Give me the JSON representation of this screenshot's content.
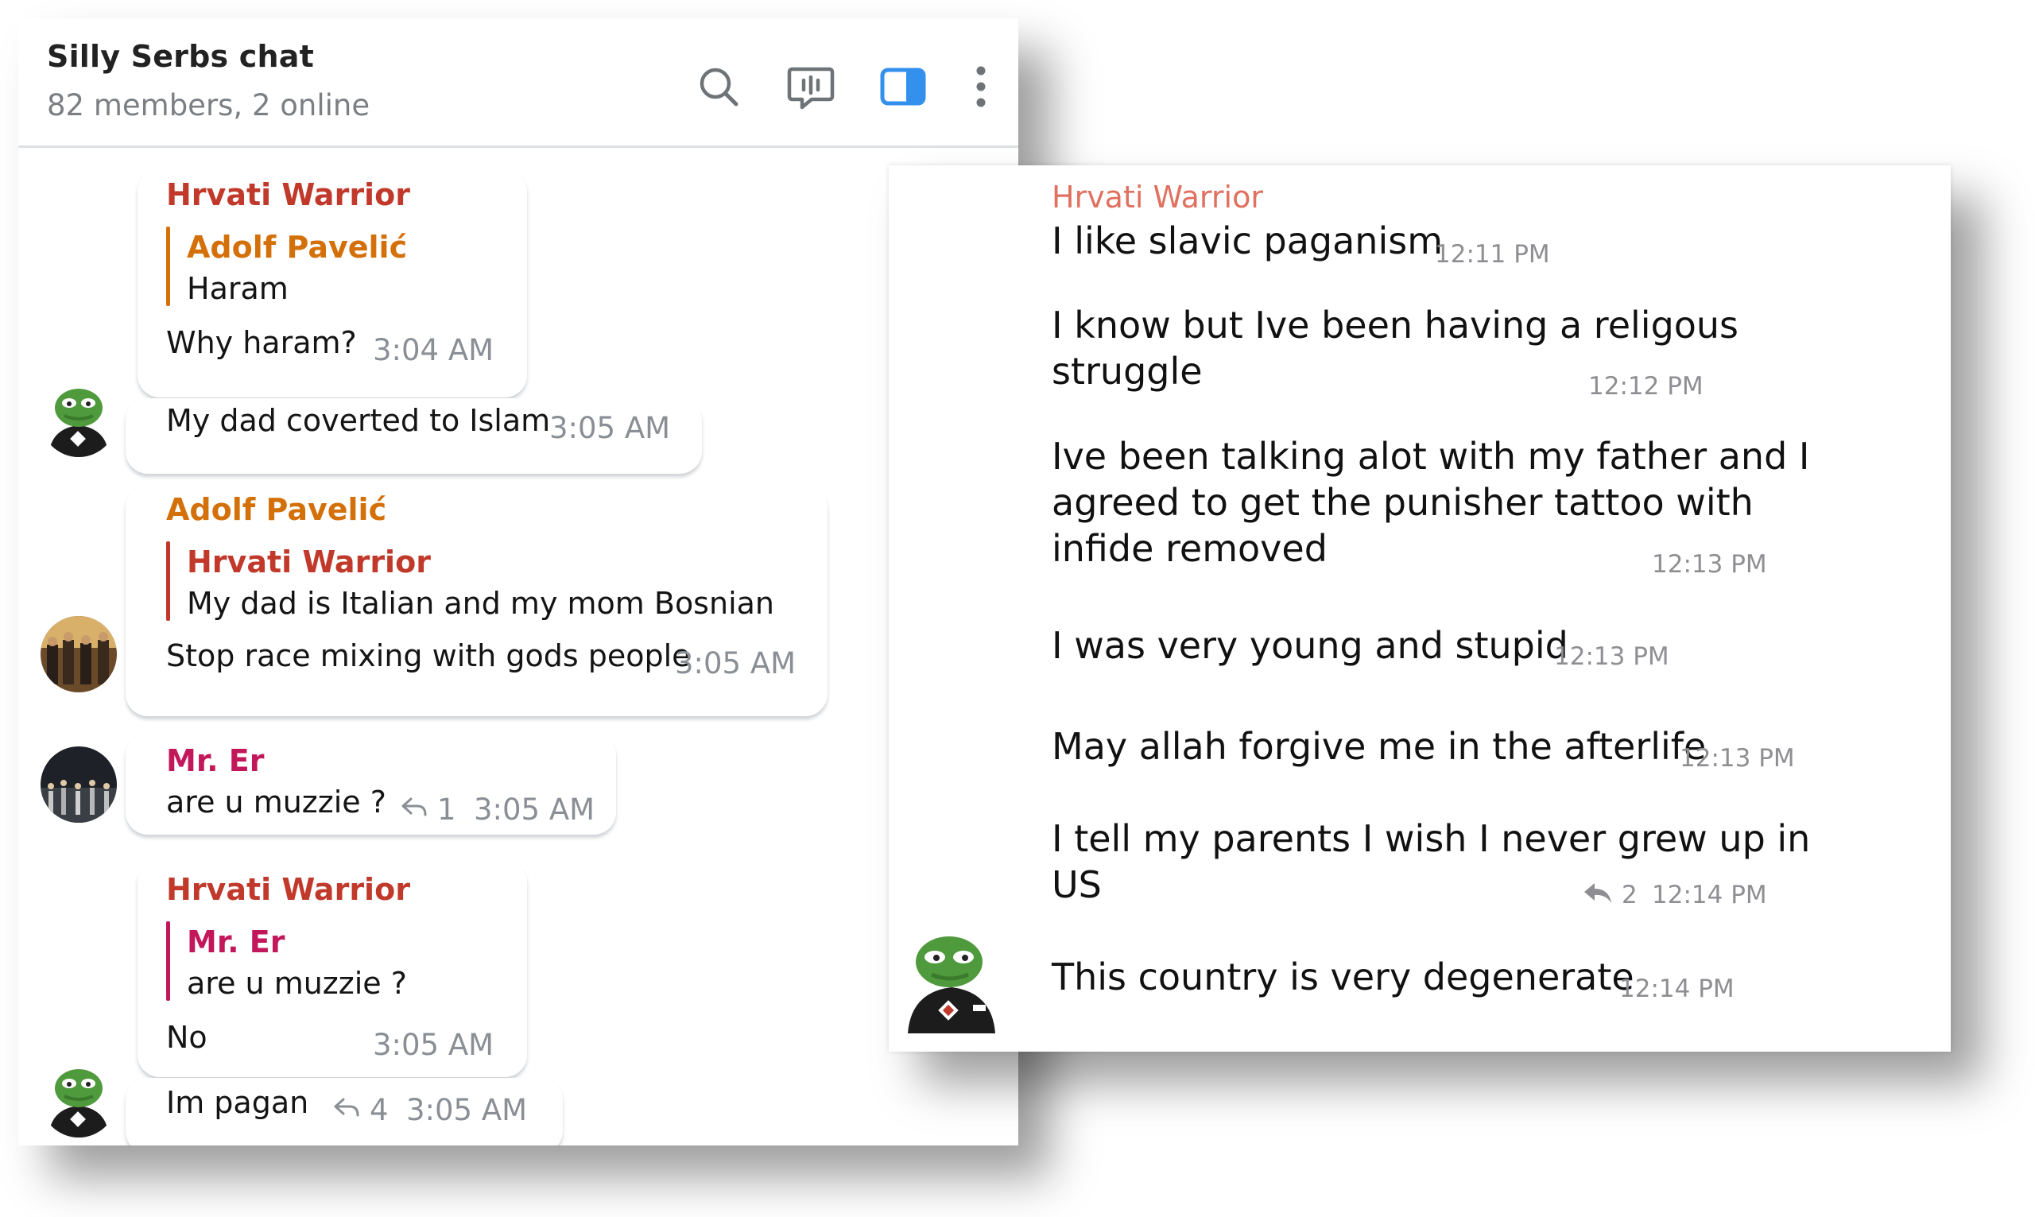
{
  "left": {
    "header": {
      "title": "Silly Serbs chat",
      "subtitle": "82 members, 2 online",
      "icons": [
        "search-icon",
        "voice-chat-icon",
        "sidebar-toggle-icon",
        "more-vertical-icon"
      ],
      "accent": "#3390ec"
    },
    "colors": {
      "hrvati": "#c0392b",
      "adolf": "#d4700a",
      "mrer": "#c2185b"
    },
    "messages": {
      "m1": {
        "sender": "Hrvati Warrior",
        "quote_name": "Adolf Pavelić",
        "quote_text": "Haram",
        "text": "Why haram?",
        "time": "3:04 AM"
      },
      "m2": {
        "text": "My dad coverted to Islam",
        "time": "3:05 AM"
      },
      "m3": {
        "sender": "Adolf Pavelić",
        "quote_name": "Hrvati Warrior",
        "quote_text": "My dad is Italian and my mom Bosnian",
        "text": "Stop race mixing with gods people",
        "time": "3:05 AM"
      },
      "m4": {
        "sender": "Mr. Er",
        "text": "are u muzzie ?",
        "replies": "1",
        "time": "3:05 AM"
      },
      "m5": {
        "sender": "Hrvati Warrior",
        "quote_name": "Mr. Er",
        "quote_text": "are u muzzie ?",
        "text": "No",
        "time": "3:05 AM"
      },
      "m6": {
        "text": "Im pagan",
        "replies": "4",
        "time": "3:05 AM"
      }
    }
  },
  "right": {
    "sender": "Hrvati Warrior",
    "messages": [
      {
        "lines": [
          "I like slavic paganism"
        ],
        "time": "12:11 PM"
      },
      {
        "lines": [
          "I know but Ive been having a religous",
          "struggle"
        ],
        "time": "12:12 PM"
      },
      {
        "lines": [
          "Ive been talking alot with my father and I",
          "agreed to get the punisher tattoo with",
          "infide removed"
        ],
        "time": "12:13 PM"
      },
      {
        "lines": [
          "I was very young and stupid"
        ],
        "time": "12:13 PM"
      },
      {
        "lines": [
          "May allah forgive me in the afterlife"
        ],
        "time": "12:13 PM"
      },
      {
        "lines": [
          "I tell my parents I wish I never grew up in",
          "US"
        ],
        "replies": "2",
        "time": "12:14 PM"
      },
      {
        "lines": [
          "This country is very degenerate"
        ],
        "time": "12:14 PM"
      }
    ]
  }
}
